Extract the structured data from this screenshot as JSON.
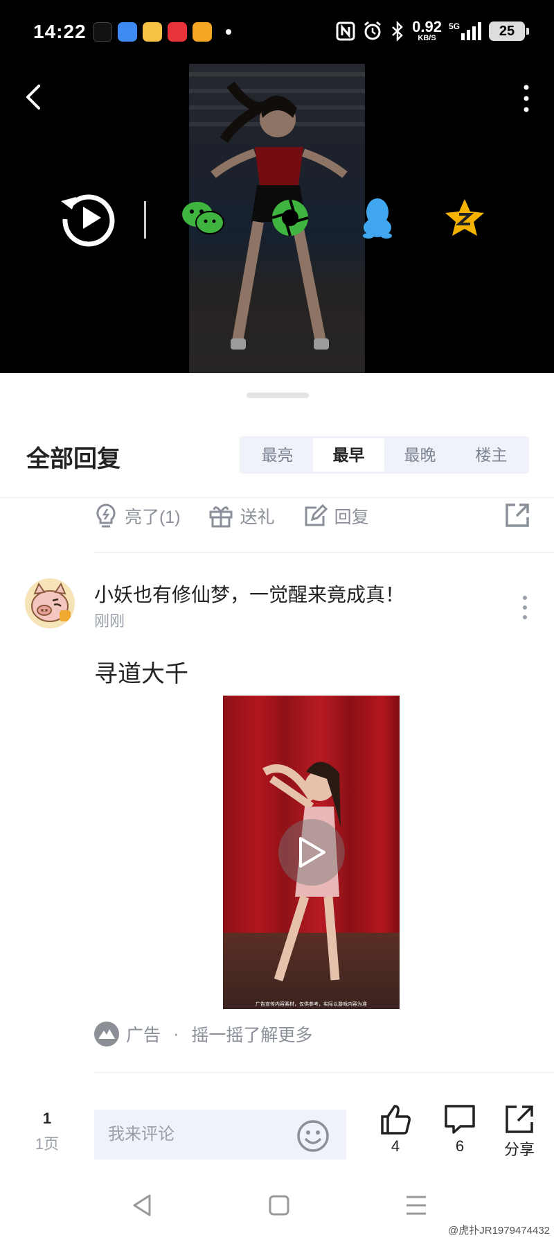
{
  "status_bar": {
    "time": "14:22",
    "net_speed": "0.92",
    "net_unit": "KB/S",
    "signal": "5G",
    "battery": "25"
  },
  "nav": {
    "back_icon": "chevron-left-icon",
    "more_icon": "vertical-dots-icon"
  },
  "share_targets": [
    "replay-icon",
    "wechat-icon",
    "moments-icon",
    "qq-icon",
    "qzone-icon"
  ],
  "comments": {
    "title": "全部回复",
    "sort_tabs": [
      {
        "label": "最亮",
        "active": false
      },
      {
        "label": "最早",
        "active": true
      },
      {
        "label": "最晚",
        "active": false
      },
      {
        "label": "楼主",
        "active": false
      }
    ]
  },
  "actions": {
    "light": "亮了(1)",
    "gift": "送礼",
    "reply": "回复"
  },
  "post": {
    "username": "小妖也有修仙梦，一觉醒来竟成真！",
    "time": "刚刚",
    "text": "寻道大千",
    "video_caption": "广告宣传内容素材，仅供参考，实际以游戏内容为准"
  },
  "ad": {
    "label": "广告",
    "separator": "·",
    "cta": "摇一摇了解更多"
  },
  "bottom_bar": {
    "page_current": "1",
    "page_label": "1页",
    "comment_placeholder": "我来评论",
    "like_count": "4",
    "comment_count": "6",
    "share_label": "分享"
  },
  "watermark": "@虎扑JR1979474432",
  "colors": {
    "wechat": "#3fb43f",
    "accent_tab_bg": "#eff2f8",
    "muted_text": "#8a8f99",
    "qzone": "#f5b300",
    "qq": "#41a6f0"
  }
}
